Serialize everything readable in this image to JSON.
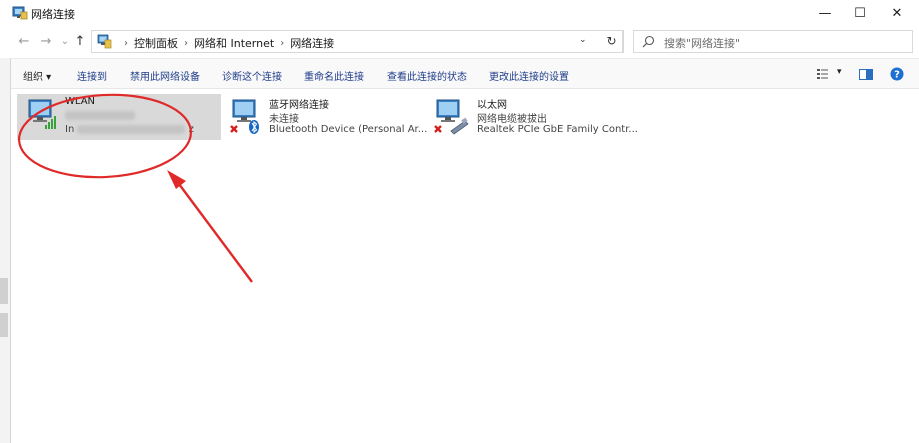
{
  "window": {
    "title": "网络连接",
    "minimize_glyph": "—",
    "maximize_glyph": "☐",
    "close_glyph": "✕"
  },
  "nav": {
    "back_glyph": "←",
    "forward_glyph": "→",
    "recent_glyph": "⌄",
    "up_glyph": "↑",
    "breadcrumbs": [
      "控制面板",
      "网络和 Internet",
      "网络连接"
    ],
    "breadcrumb_sep": "›",
    "dropdown_glyph": "⌄",
    "refresh_glyph": "↻",
    "search_placeholder": "搜索\"网络连接\""
  },
  "toolbar": {
    "organize": "组织 ▾",
    "connect_to": "连接到",
    "disable_device": "禁用此网络设备",
    "diagnose": "诊断这个连接",
    "rename": "重命名此连接",
    "view_status": "查看此连接的状态",
    "change_settings": "更改此连接的设置",
    "view_menu_glyph": "▾",
    "help_glyph": "?"
  },
  "connections": [
    {
      "name": "WLAN",
      "status_prefix": "In",
      "device_suffix": "z",
      "icon": "wifi-adapter-icon",
      "selected": true
    },
    {
      "name": "蓝牙网络连接",
      "status": "未连接",
      "device": "Bluetooth Device (Personal Ar...",
      "icon": "bluetooth-adapter-icon",
      "selected": false
    },
    {
      "name": "以太网",
      "status": "网络电缆被拔出",
      "device": "Realtek PCIe GbE Family Contr...",
      "icon": "ethernet-adapter-icon",
      "selected": false
    }
  ],
  "colors": {
    "annotation": "#e02a2a",
    "selection": "#d9d9d9",
    "command_text": "#1f3d8a",
    "help": "#1c6fd1"
  }
}
